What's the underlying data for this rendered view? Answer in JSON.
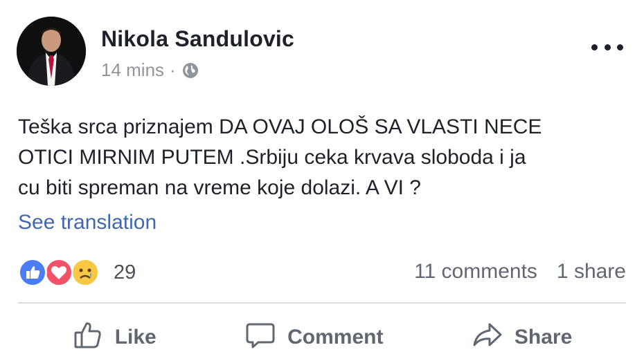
{
  "post": {
    "author": "Nikola Sandulovic",
    "time": "14 mins",
    "separator": "·",
    "audience_icon": "globe-icon",
    "more_icon": "ellipsis-icon",
    "text": "Teška srca priznajem DA OVAJ OLOŠ SA VLASTI NECE\nOTICI MIRNIM PUTEM .Srbiju ceka krvava sloboda i ja\ncu biti spreman na vreme koje dolazi. A VI ?",
    "see_translation": "See translation"
  },
  "reactions": {
    "icons": [
      "like-reaction-icon",
      "love-reaction-icon",
      "sad-reaction-icon"
    ],
    "colors": {
      "like": "#4a7cf6",
      "love": "#f25268",
      "sad": "#f7c843"
    },
    "count": "29"
  },
  "stats": {
    "comments": "11 comments",
    "shares": "1 share"
  },
  "actions": {
    "like": "Like",
    "comment": "Comment",
    "share": "Share"
  },
  "colors": {
    "text": "#1d2129",
    "meta": "#90949c",
    "link": "#4267b2",
    "action": "#606770"
  }
}
